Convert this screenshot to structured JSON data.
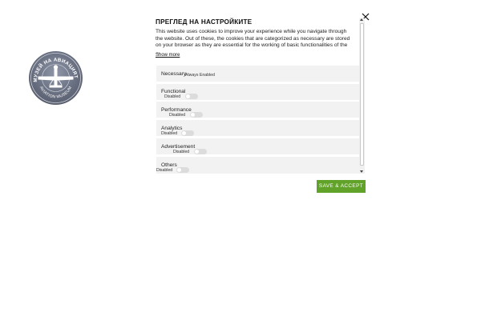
{
  "logo": {
    "text_top": "МУЗЕЙ НА АВИАЦИЯТА",
    "text_bottom": "AVIATION MUSEUM",
    "icon": "airplane-icon"
  },
  "modal": {
    "title": "ПРЕГЛЕД НА НАСТРОЙКИТЕ",
    "description": "This website uses cookies to improve your experience while you navigate through the website. Out of these, the cookies that are categorized as necessary are stored on your browser as they are essential for the working of basic functionalities of the ...",
    "show_more": "Show more",
    "close_icon": "close-icon"
  },
  "categories": [
    {
      "name": "Necessary",
      "status": "Always Enabled"
    },
    {
      "name": "Functional",
      "status": "Disabled",
      "enabled": false
    },
    {
      "name": "Performance",
      "status": "Disabled",
      "enabled": false
    },
    {
      "name": "Analytics",
      "status": "Disabled",
      "enabled": false
    },
    {
      "name": "Advertisement",
      "status": "Disabled",
      "enabled": false
    },
    {
      "name": "Others",
      "status": "Disabled",
      "enabled": false
    }
  ],
  "actions": {
    "save_accept": "SAVE & ACCEPT"
  },
  "colors": {
    "accent_green": "#61a229",
    "category_bg": "#f2f2f2",
    "toggle_off": "#dcdcdc",
    "logo_bg": "#6c7385"
  }
}
